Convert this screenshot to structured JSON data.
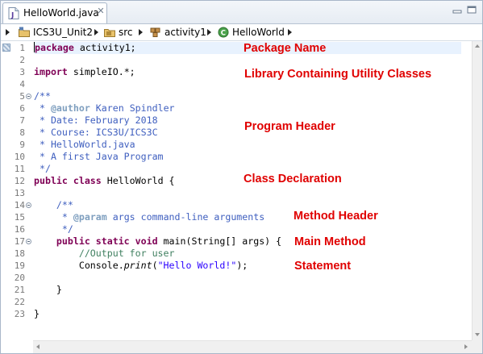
{
  "tab": {
    "title": "HelloWorld.java",
    "close_glyph": "✕"
  },
  "breadcrumb": [
    {
      "label": "ICS3U_Unit2",
      "icon": "project-folder-icon"
    },
    {
      "label": "src",
      "icon": "source-folder-icon"
    },
    {
      "label": "activity1",
      "icon": "package-icon"
    },
    {
      "label": "HelloWorld",
      "icon": "class-icon"
    }
  ],
  "line_numbers": [
    "1",
    "2",
    "3",
    "4",
    "5",
    "6",
    "7",
    "8",
    "9",
    "10",
    "11",
    "12",
    "13",
    "14",
    "15",
    "16",
    "17",
    "18",
    "19",
    "20",
    "21",
    "22",
    "23"
  ],
  "code": {
    "l1_kw": "package",
    "l1_rest": " activity1;",
    "l3_kw": "import",
    "l3_rest": " simpleIO.*;",
    "l5": "/**",
    "l6_a": " * ",
    "l6_tag": "@author",
    "l6_b": " Karen Spindler",
    "l7": " * Date: February 2018",
    "l8": " * Course: ICS3U/ICS3C",
    "l9": " * HelloWorld.java",
    "l10": " * A first Java Program",
    "l11": " */",
    "l12_kw": "public class",
    "l12_rest": " HelloWorld {",
    "l14": "    /**",
    "l15_a": "     * ",
    "l15_tag": "@param",
    "l15_b": " args command-line arguments",
    "l16": "     */",
    "l17_a": "    ",
    "l17_kw": "public static void",
    "l17_rest": " main(String[] args) {",
    "l18": "        //Output for user",
    "l19_a": "        Console.",
    "l19_method": "print",
    "l19_b": "(",
    "l19_str": "\"Hello World!\"",
    "l19_c": ");",
    "l21": "    }",
    "l23": "}"
  },
  "annotations": {
    "package_name": "Package Name",
    "library": "Library Containing Utility Classes",
    "program_header": "Program Header",
    "class_declaration": "Class Declaration",
    "method_header": "Method Header",
    "main_method": "Main Method",
    "statement": "Statement"
  },
  "colors": {
    "keyword": "#7f0055",
    "javadoc": "#3f5fbf",
    "javadoc_tag": "#7f9fbf",
    "line_comment": "#3f7f5f",
    "string": "#2a00ff",
    "annotation_text": "#e00000",
    "current_line": "#e8f2fe"
  }
}
